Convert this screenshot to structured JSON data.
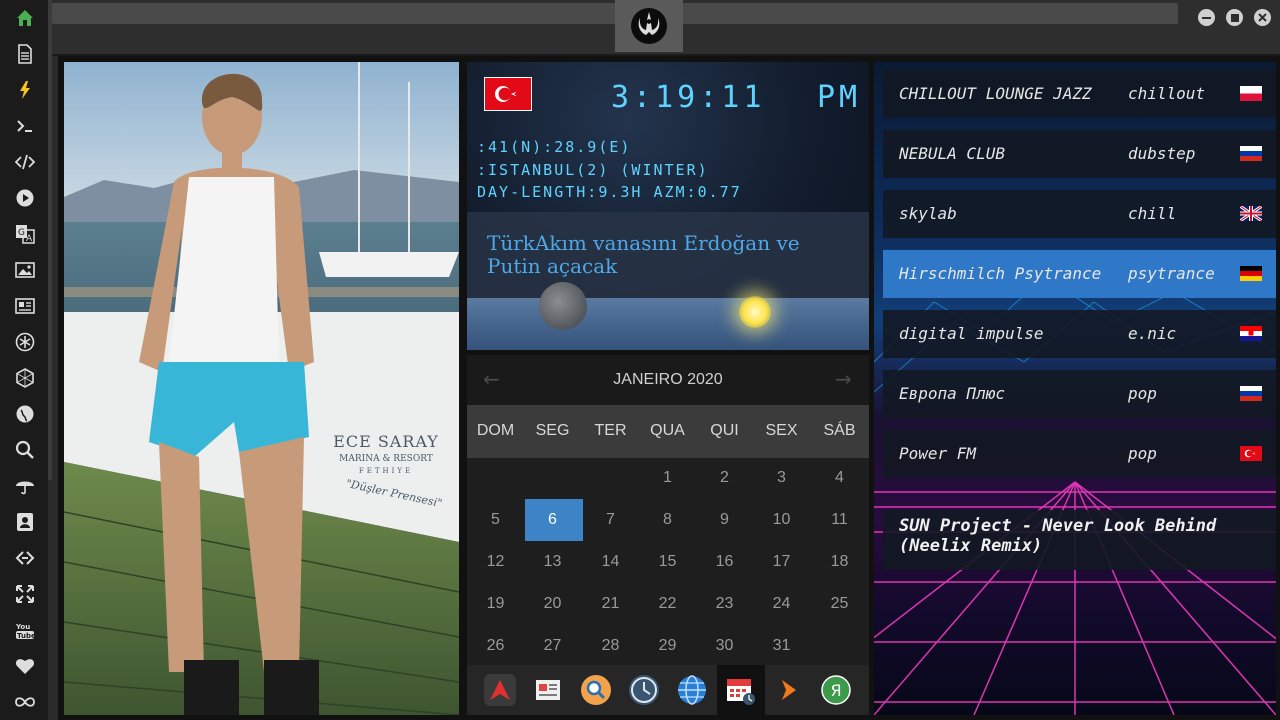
{
  "clock": {
    "time": "3:19:11",
    "ampm": "PM",
    "coord_line1": ":41(N):28.9(E)",
    "coord_line2": ":ISTANBUL(2) (WINTER)",
    "coord_line3": "DAY-LENGTH:9.3H AZM:0.77",
    "news": "TürkAkım vanasını Erdoğan ve Putin açacak"
  },
  "calendar": {
    "title": "JANEIRO 2020",
    "weekdays": [
      "DOM",
      "SEG",
      "TER",
      "QUA",
      "QUI",
      "SEX",
      "SÁB"
    ],
    "weeks": [
      [
        "",
        "",
        "",
        "1",
        "2",
        "3",
        "4"
      ],
      [
        "5",
        "6",
        "7",
        "8",
        "9",
        "10",
        "11"
      ],
      [
        "12",
        "13",
        "14",
        "15",
        "16",
        "17",
        "18"
      ],
      [
        "19",
        "20",
        "21",
        "22",
        "23",
        "24",
        "25"
      ],
      [
        "26",
        "27",
        "28",
        "29",
        "30",
        "31",
        ""
      ]
    ],
    "selected": "6"
  },
  "photo": {
    "banner_brand": "ECE SARAY",
    "banner_sub": "MARINA & RESORT",
    "banner_place": "FETHIYE",
    "banner_slogan": "\"Düşler Prensesi\""
  },
  "stations": [
    {
      "name": "CHILLOUT LOUNGE JAZZ",
      "genre": "chillout",
      "flag": "poland"
    },
    {
      "name": "NEBULA CLUB",
      "genre": "dubstep",
      "flag": "russia"
    },
    {
      "name": "skylab",
      "genre": "chill",
      "flag": "uk"
    },
    {
      "name": "Hirschmilch Psytrance",
      "genre": "psytrance",
      "flag": "germany"
    },
    {
      "name": "digital impulse",
      "genre": "e.nic",
      "flag": "croatia"
    },
    {
      "name": "Европа Плюс",
      "genre": "pop",
      "flag": "russia"
    },
    {
      "name": "Power FM",
      "genre": "pop",
      "flag": "turkey"
    }
  ],
  "now_playing": "SUN Project - Never Look Behind (Neelix Remix)",
  "sidebar_icons": [
    "home-icon",
    "document-icon",
    "lightning-icon",
    "terminal-icon",
    "code-icon",
    "play-icon",
    "translate-icon",
    "image-icon",
    "news-icon",
    "asterisk-icon",
    "hexagon-icon",
    "globe-icon",
    "search-icon",
    "umbrella-icon",
    "contact-icon",
    "link-icon",
    "expand-icon",
    "youtube-icon",
    "heart-icon",
    "infinity-icon"
  ],
  "dock_icons": [
    "arrow-app-icon",
    "newspaper-icon",
    "magnifier-icon",
    "clock-icon",
    "globe-icon",
    "calendar-icon",
    "play-arrow-icon",
    "yandex-icon"
  ],
  "colors": {
    "accent": "#3d84c6",
    "clock_text": "#5fd3ff",
    "highlight_station": "#2f78c8"
  }
}
